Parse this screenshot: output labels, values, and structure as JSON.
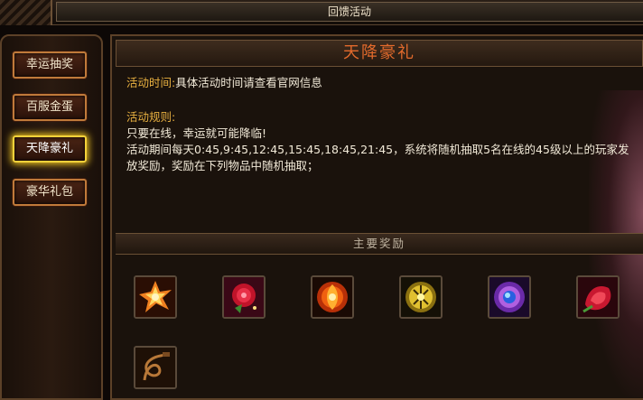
{
  "window": {
    "title": "回馈活动"
  },
  "sidebar": {
    "items": [
      {
        "label": "幸运抽奖",
        "active": false
      },
      {
        "label": "百服金蛋",
        "active": false
      },
      {
        "label": "天降豪礼",
        "active": true
      },
      {
        "label": "豪华礼包",
        "active": false
      }
    ]
  },
  "main": {
    "title": "天降豪礼",
    "time_label": "活动时间:",
    "time_value": "具体活动时间请查看官网信息",
    "rules_label": "活动规则:",
    "rules_text": "只要在线，幸运就可能降临!\n活动期间每天0:45,9:45,12:45,15:45,18:45,21:45，系统将随机抽取5名在线的45级以上的玩家发放奖励，奖励在下列物品中随机抽取；",
    "rewards_header": "主要奖励",
    "rewards": [
      {
        "icon": "fire-crystal-icon"
      },
      {
        "icon": "red-rose-gem-icon"
      },
      {
        "icon": "flame-orb-icon"
      },
      {
        "icon": "golden-rune-orb-icon"
      },
      {
        "icon": "blue-jewel-icon"
      },
      {
        "icon": "red-rose-icon"
      },
      {
        "icon": "whip-icon"
      }
    ]
  },
  "colors": {
    "accent_title": "#e26a2c",
    "label": "#e8b040",
    "active_border": "#f6d23a",
    "button_border": "#c07a3a"
  }
}
